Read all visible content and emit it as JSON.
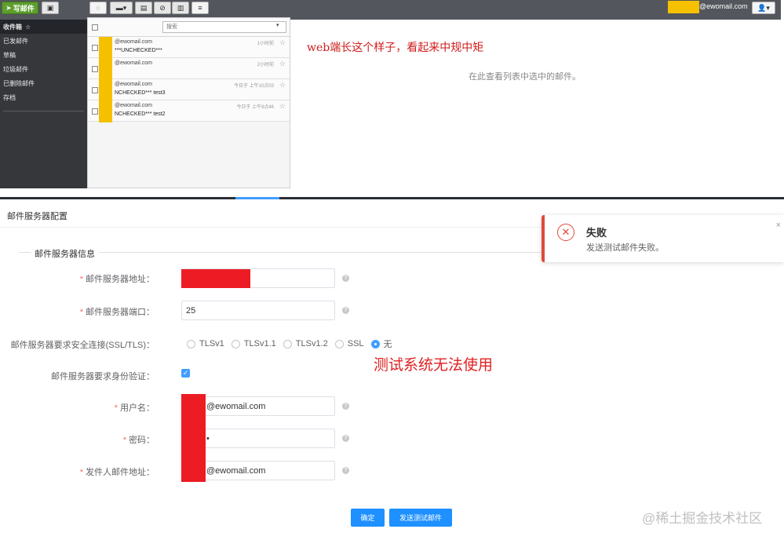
{
  "webmail": {
    "toolbar": {
      "compose_label": "写邮件",
      "user_email": "@ewomail.com"
    },
    "sidebar": {
      "items": [
        {
          "label": "收件箱",
          "star": "☆"
        },
        {
          "label": "已发邮件"
        },
        {
          "label": "草稿"
        },
        {
          "label": "垃圾邮件"
        },
        {
          "label": "已删除邮件"
        },
        {
          "label": "存档"
        }
      ]
    },
    "search": {
      "placeholder": "搜索"
    },
    "messages": [
      {
        "from": "@ewomail.com",
        "subject": "***UNCHECKED***",
        "time": "1小时前"
      },
      {
        "from": "@ewomail.com",
        "subject": "",
        "time": "2小时前"
      },
      {
        "from": "@ewomail.com",
        "subject": "NCHECKED*** test3",
        "time": "今日于 上午10点03"
      },
      {
        "from": "@ewomail.com",
        "subject": "NCHECKED*** test2",
        "time": "今日于 上午9点46"
      }
    ],
    "preview_empty": "在此查看列表中选中的邮件。"
  },
  "annotations": {
    "top_note": "web端长这个样子，看起来中规中矩",
    "bottom_note": "测试系统无法使用"
  },
  "config": {
    "title": "邮件服务器配置",
    "fieldset_legend": "邮件服务器信息",
    "fields": {
      "server_address": {
        "label": "邮件服务器地址：",
        "value": ""
      },
      "server_port": {
        "label": "邮件服务器端口：",
        "value": "25"
      },
      "security": {
        "label": "邮件服务器要求安全连接(SSL/TLS)：",
        "options": [
          "TLSv1",
          "TLSv1.1",
          "TLSv1.2",
          "SSL",
          "无"
        ],
        "selected": "无"
      },
      "auth_required": {
        "label": "邮件服务器要求身份验证：",
        "checked": true
      },
      "username": {
        "label": "用户名：",
        "value": "@ewomail.com"
      },
      "password": {
        "label": "密码：",
        "value": "•"
      },
      "sender_address": {
        "label": "发件人邮件地址：",
        "value": "@ewomail.com"
      }
    },
    "buttons": {
      "confirm": "确定",
      "send_test": "发送测试邮件"
    },
    "notification": {
      "title": "失败",
      "message": "发送测试邮件失败。",
      "close": "×"
    }
  },
  "watermark": "@稀土掘金技术社区",
  "colors": {
    "primary": "#409eff",
    "danger": "#e04a3a",
    "mask_yellow": "#f5c000",
    "mask_red": "#ed1c24",
    "annotation_red": "#d01c1c"
  }
}
